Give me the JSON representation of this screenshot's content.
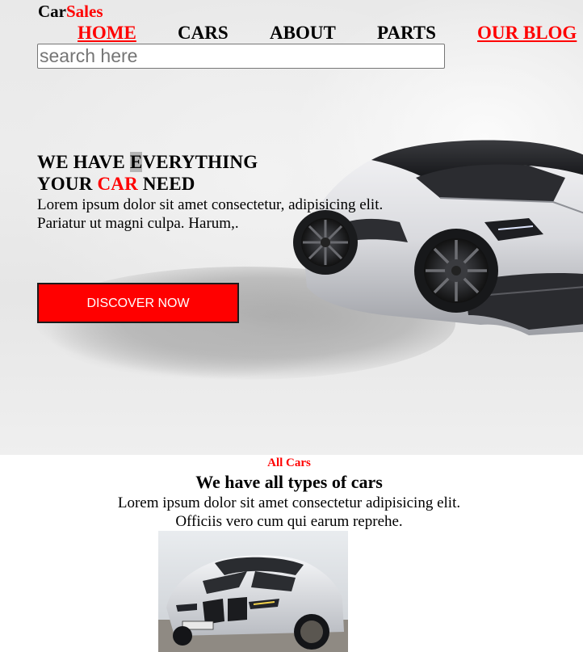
{
  "header": {
    "logo_part1": "Car",
    "logo_part2": "Sales",
    "nav": {
      "home": "HOME",
      "cars": "CARS",
      "about": "ABOUT",
      "parts": "PARTS",
      "blog": "OUR BLOG"
    },
    "search_placeholder": "search here"
  },
  "hero": {
    "headline_line1_a": "WE HAVE ",
    "headline_line1_sel": "E",
    "headline_line1_b": "VERYTHING",
    "headline_line2_a": "YOUR ",
    "headline_line2_red": "CAR",
    "headline_line2_b": " NEED",
    "text_line1": "Lorem ipsum dolor sit amet consectetur, adipisicing elit.",
    "text_line2": "Pariatur ut magni culpa. Harum,.",
    "button": "DISCOVER NOW"
  },
  "cars_section": {
    "label": "All Cars",
    "title": "We have all types of cars",
    "text_line1": "Lorem ipsum dolor sit amet consectetur adipisicing elit.",
    "text_line2": "Officiis vero cum qui earum reprehe."
  },
  "colors": {
    "accent": "#ff0000",
    "text": "#000000",
    "button_text": "#ffffff"
  }
}
